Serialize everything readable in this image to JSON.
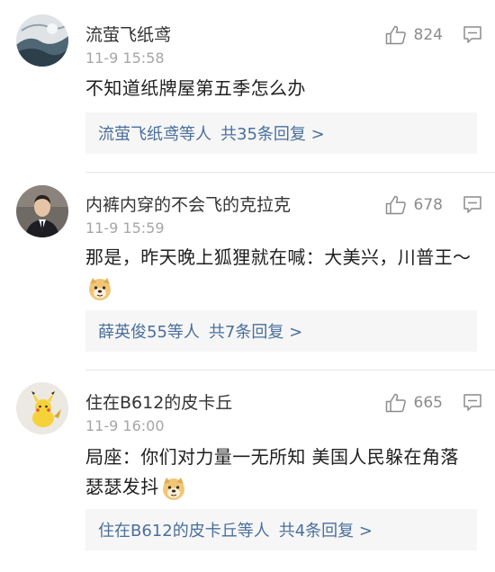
{
  "comments": [
    {
      "avatar": "landscape-avatar",
      "username": "流萤飞纸鸢",
      "time": "11-9 15:58",
      "likes": "824",
      "content": "不知道纸牌屋第五季怎么办",
      "replies": {
        "who": "流萤飞纸鸢",
        "suffix": "等人",
        "count": "共35条回复 >"
      }
    },
    {
      "avatar": "man-in-suit-avatar",
      "username": "内裤内穿的不会飞的克拉克",
      "time": "11-9 15:59",
      "likes": "678",
      "content": "那是，昨天晚上狐狸就在喊：大美兴，川普王～",
      "emoji": "doge-emoji",
      "replies": {
        "who": "薛英俊55",
        "suffix": "等人",
        "count": "共7条回复 >"
      }
    },
    {
      "avatar": "pikachu-avatar",
      "username": "住在B612的皮卡丘",
      "time": "11-9 16:00",
      "likes": "665",
      "content": "局座：你们对力量一无所知 美国人民躲在角落瑟瑟发抖",
      "emoji": "doge-emoji",
      "replies": {
        "who": "住在B612的皮卡丘",
        "suffix": "等人",
        "count": "共4条回复 >"
      }
    }
  ]
}
